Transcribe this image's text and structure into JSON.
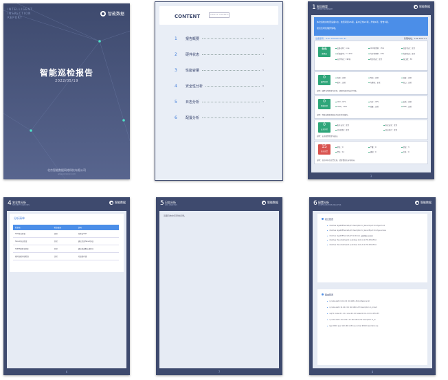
{
  "cover": {
    "deco_lines": [
      "INTELLIGENT",
      "INSPECTION",
      "REPORT"
    ],
    "logo_text": "智能数据",
    "title": "智能巡检报告",
    "date": "2022/05/19",
    "company": "北京智能数据网络科技有限公司",
    "site": "www.xxxxxx.com"
  },
  "toc": {
    "heading": "CONTENT",
    "subheading": "TABLE OF CONTENTS",
    "items": [
      {
        "num": "1",
        "label": "报告概要",
        "page": "3"
      },
      {
        "num": "2",
        "label": "硬件状态",
        "page": "4"
      },
      {
        "num": "3",
        "label": "性能容量",
        "page": "5"
      },
      {
        "num": "4",
        "label": "安全性分析",
        "page": "6"
      },
      {
        "num": "5",
        "label": "日志分析",
        "page": "7"
      },
      {
        "num": "6",
        "label": "配置分析",
        "page": "8"
      }
    ]
  },
  "page3": {
    "num": "1",
    "title": "报告概要",
    "subtitle": "REPORT SUMMARY",
    "logo_text": "智能数据",
    "banner_lines": [
      "本次巡检共检查设备1台，检查项目26项，其中正常22项，异常2项，警告2项。",
      "建议及时处理异常项。"
    ],
    "device_line": "设备型号：H3C S5560X-30C-EI",
    "device_right": "管理地址：192.168.1.1",
    "cards": [
      {
        "value": "66",
        "label": "健康度",
        "color": "#2fa67a",
        "kv": [
          "设备名称：core",
          "CPU利用率：15%",
          "温度状态：正常",
          "系统版本：7.1.070",
          "内存利用率：43%",
          "电源状态：正常",
          "运行时间：192天",
          "风扇状态：正常",
          "端口数：30"
        ],
        "note": ""
      },
      {
        "value": "0",
        "label": "硬件异常",
        "color": "#2fa67a",
        "kv": [
          "电源：正常",
          "风扇：正常",
          "温度：正常",
          "板卡：正常",
          "光模块：正常",
          "接口：正常"
        ],
        "note": "说明：硬件各项检查均正常，请保持良好的运行环境。"
      },
      {
        "value": "0",
        "label": "性能异常",
        "color": "#2fa67a",
        "kv": [
          "CPU：15%",
          "内存：43%",
          "会话：正常",
          "Flash：38%",
          "流量：正常",
          "ARP：正常"
        ],
        "note": "说明：性能容量各项指标均在正常范围内。"
      },
      {
        "value": "0",
        "label": "安全异常",
        "color": "#2fa67a",
        "kv": [
          "账号安全：正常",
          "协议安全：正常",
          "访问控制：正常",
          "日志审计：正常"
        ],
        "note": "说明：安全配置检查均通过。"
      },
      {
        "value": "15",
        "label": "日志告警",
        "color": "#d9534f",
        "kv": [
          "紧急：0",
          "严重：0",
          "错误：3",
          "警告：12",
          "通知：0",
          "信息：0"
        ],
        "note": "说明：日志中存在告警信息，请查看日志分析章节。"
      }
    ],
    "footer": "3"
  },
  "page4": {
    "num": "4",
    "title": "安全性分析",
    "subtitle": "SECURITY ANALYSIS",
    "logo_text": "智能数据",
    "section": "分析清单",
    "columns": [
      "检查项",
      "检查结果",
      "说明"
    ],
    "rows": [
      [
        "SSH协议检查",
        "正常",
        "已开启SSH"
      ],
      [
        "Telnet协议检查",
        "异常",
        "建议关闭Telnet协议"
      ],
      [
        "SNMP团体字检查",
        "异常",
        "建议修改默认团体字"
      ],
      [
        "密码加密存储检查",
        "正常",
        "已加密存储"
      ]
    ],
    "footer": "6"
  },
  "page5": {
    "num": "5",
    "title": "日志分析",
    "subtitle": "LOG ANALYSIS",
    "logo_text": "智能数据",
    "body_text": "近期日志中无异常记录。",
    "footer": "7"
  },
  "page6": {
    "num": "6",
    "title": "配置分析",
    "subtitle": "CONFIGURATION ANALYSIS",
    "logo_text": "智能数据",
    "sec1": {
      "heading": "接口配置",
      "items": [
        "interface GigabitEthernet1/0/1 description to_ServerA port link-type trunk",
        "interface GigabitEthernet1/0/2 description to_ServerB port link-type access",
        "interface GigabitEthernet1/0/3 shutdown 未使用端口已关闭",
        "interface Vlan-interface10 ip address 10.1.10.1 255.255.255.0",
        "interface Vlan-interface20 ip address 10.1.20.1 255.255.255.0"
      ]
    },
    "sec2": {
      "heading": "路由配置",
      "items": [
        "ip route-static 0.0.0.0 0 192.168.1.254 preference 60",
        "ip route-static 10.2.0.0 16 192.168.1.253 description to_branch",
        "ospf 1 router-id 1.1.1.1 area 0.0.0.0 network 10.1.0.0 0.0.255.255",
        "ip route-static 172.16.0.0 12 192.168.1.252 description to_dc",
        "bgp 65001 peer 192.168.1.250 as-number 65002 description isp"
      ]
    },
    "footer": "8"
  }
}
